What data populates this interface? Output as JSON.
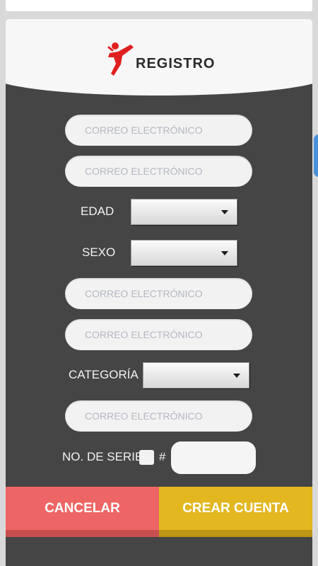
{
  "header": {
    "title": "REGISTRO",
    "logo": "kick-figure-logo"
  },
  "form": {
    "field_1": {
      "placeholder": "CORREO ELECTRÓNICO",
      "value": ""
    },
    "field_2": {
      "placeholder": "CORREO ELECTRÓNICO",
      "value": ""
    },
    "edad": {
      "label": "EDAD",
      "selected": ""
    },
    "sexo": {
      "label": "SEXO",
      "selected": ""
    },
    "field_3": {
      "placeholder": "CORREO ELECTRÓNICO",
      "value": ""
    },
    "field_4": {
      "placeholder": "CORREO ELECTRÓNICO",
      "value": ""
    },
    "categoria": {
      "label": "CATEGORÍA",
      "selected": ""
    },
    "field_5": {
      "placeholder": "CORREO ELECTRÓNICO",
      "value": ""
    },
    "serie": {
      "label": "NO. DE SERIE",
      "hash": "#",
      "checked": false,
      "value": ""
    }
  },
  "buttons": {
    "cancel": "CANCELAR",
    "create": "CREAR CUENTA"
  },
  "colors": {
    "panel": "#454545",
    "cancel": "#ee6565",
    "create": "#e2b720",
    "logo": "#e02020"
  }
}
